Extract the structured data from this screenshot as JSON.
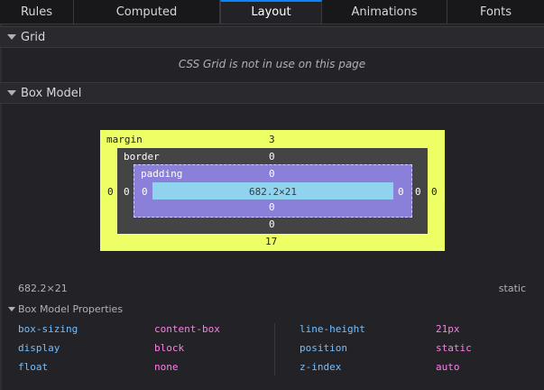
{
  "tabs": [
    {
      "label": "Rules"
    },
    {
      "label": "Computed"
    },
    {
      "label": "Layout"
    },
    {
      "label": "Animations"
    },
    {
      "label": "Fonts"
    }
  ],
  "grid": {
    "title": "Grid",
    "message": "CSS Grid is not in use on this page"
  },
  "box_model": {
    "title": "Box Model",
    "margin": {
      "label": "margin",
      "top": "3",
      "right": "0",
      "bottom": "17",
      "left": "0"
    },
    "border": {
      "label": "border",
      "top": "0",
      "right": "0",
      "bottom": "0",
      "left": "0"
    },
    "padding": {
      "label": "padding",
      "top": "0",
      "right": "0",
      "bottom": "0",
      "left": "0"
    },
    "content": "682.2×21"
  },
  "summary": {
    "dimensions": "682.2×21",
    "position": "static"
  },
  "properties": {
    "title": "Box Model Properties",
    "items": [
      {
        "name": "box-sizing",
        "value": "content-box"
      },
      {
        "name": "display",
        "value": "block"
      },
      {
        "name": "float",
        "value": "none"
      },
      {
        "name": "line-height",
        "value": "21px"
      },
      {
        "name": "position",
        "value": "static"
      },
      {
        "name": "z-index",
        "value": "auto"
      }
    ]
  }
}
